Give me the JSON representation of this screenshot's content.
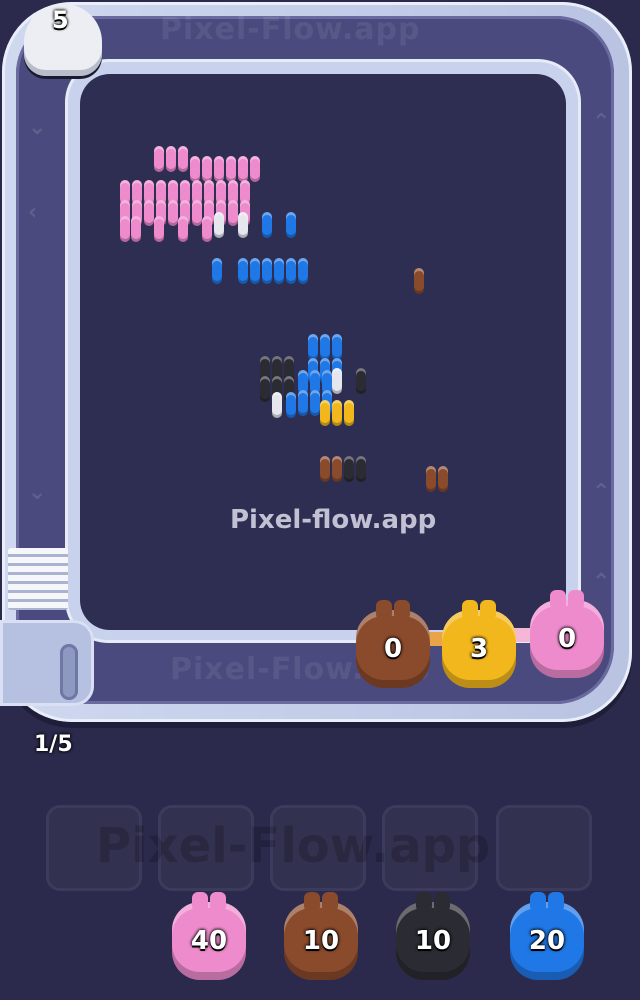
{
  "watermark": "Pixel-flow.app",
  "track_watermark_top": "Pixel-Flow.app",
  "track_watermark_bottom": "Pixel-Flow.app",
  "lives": "5",
  "progress": "1/5",
  "conveyor_pigs": [
    {
      "color": "brown",
      "count": "0"
    },
    {
      "color": "yellow",
      "count": "3"
    },
    {
      "color": "pink",
      "count": "0"
    }
  ],
  "queue_pigs": [
    {
      "color": "pink",
      "count": "40"
    },
    {
      "color": "brown",
      "count": "10"
    },
    {
      "color": "black",
      "count": "10"
    },
    {
      "color": "blue",
      "count": "20"
    }
  ],
  "empty_slots": 5,
  "bottom_watermark": "Pixel-Flow.app",
  "colors": {
    "pink": "#ee8bcd",
    "brown": "#8a4a2c",
    "black": "#2b2b33",
    "blue": "#1f78e6",
    "yellow": "#f2b71c",
    "white": "#e6e6ee",
    "board": "#2e2d52",
    "track": "#4a4a7e"
  }
}
